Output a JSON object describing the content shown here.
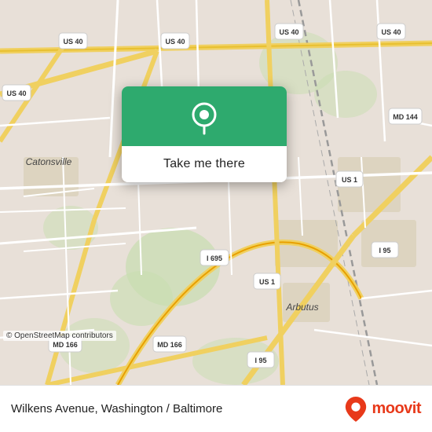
{
  "map": {
    "attribution": "© OpenStreetMap contributors",
    "background_color": "#e8e0d8"
  },
  "popup": {
    "button_label": "Take me there",
    "pin_color": "#ffffff",
    "header_bg": "#2eaa6e"
  },
  "bottom_bar": {
    "location_label": "Wilkens Avenue, Washington / Baltimore",
    "moovit_text": "moovit"
  },
  "road_labels": {
    "us40_1": "US 40",
    "us40_2": "US 40",
    "us40_3": "US 40",
    "us40_4": "US 40",
    "us1_1": "US 1",
    "us1_2": "US 1",
    "i695": "I 695",
    "i95_1": "I 95",
    "i95_2": "I 95",
    "md166_1": "MD 166",
    "md166_2": "MD 166",
    "md144": "MD 144",
    "catonsville": "Catonsville",
    "arbutus": "Arbutus"
  }
}
